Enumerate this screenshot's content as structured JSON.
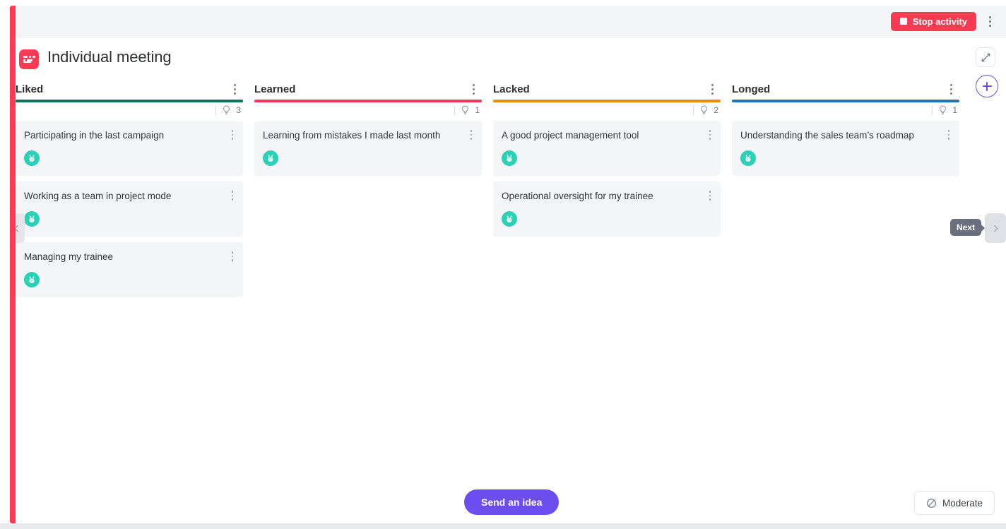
{
  "toolbar": {
    "stop_label": "Stop activity",
    "stop_color": "#fb3b54",
    "kebab_icon": "kebab-vertical-icon"
  },
  "header": {
    "title": "Individual meeting",
    "logo_icon": "app-logo-icon",
    "collapse_icon": "collapse-diagonal-icon",
    "add_icon": "plus-icon",
    "accent_color": "#6c4ef0"
  },
  "columns": [
    {
      "title": "Liked",
      "color": "#00795a",
      "count": "3",
      "idea_icon": "lightbulb-icon",
      "menu_icon": "kebab-vertical-icon",
      "cards": [
        {
          "text": "Participating in the last campaign",
          "avatar_icon": "rabbit-avatar-icon",
          "menu_icon": "kebab-vertical-icon"
        },
        {
          "text": "Working as a team in project mode",
          "avatar_icon": "rabbit-avatar-icon",
          "menu_icon": "kebab-vertical-icon"
        },
        {
          "text": "Managing my trainee",
          "avatar_icon": "rabbit-avatar-icon",
          "menu_icon": "kebab-vertical-icon"
        }
      ]
    },
    {
      "title": "Learned",
      "color": "#f8345a",
      "count": "1",
      "idea_icon": "lightbulb-icon",
      "menu_icon": "kebab-vertical-icon",
      "cards": [
        {
          "text": "Learning from mistakes I made last month",
          "avatar_icon": "rabbit-avatar-icon",
          "menu_icon": "kebab-vertical-icon"
        }
      ]
    },
    {
      "title": "Lacked",
      "color": "#f28b00",
      "count": "2",
      "idea_icon": "lightbulb-icon",
      "menu_icon": "kebab-vertical-icon",
      "cards": [
        {
          "text": "A good project management tool",
          "avatar_icon": "rabbit-avatar-icon",
          "menu_icon": "kebab-vertical-icon"
        },
        {
          "text": "Operational oversight for my trainee",
          "avatar_icon": "rabbit-avatar-icon",
          "menu_icon": "kebab-vertical-icon"
        }
      ]
    },
    {
      "title": "Longed",
      "color": "#1476c6",
      "count": "1",
      "idea_icon": "lightbulb-icon",
      "menu_icon": "kebab-vertical-icon",
      "cards": [
        {
          "text": "Understanding the sales team’s roadmap",
          "avatar_icon": "rabbit-avatar-icon",
          "menu_icon": "kebab-vertical-icon"
        }
      ]
    }
  ],
  "navigation": {
    "prev_icon": "chevron-left-icon",
    "next_icon": "chevron-right-icon",
    "next_tooltip": "Next"
  },
  "footer": {
    "send_label": "Send an idea",
    "moderate_label": "Moderate",
    "moderate_icon": "no-entry-icon"
  }
}
